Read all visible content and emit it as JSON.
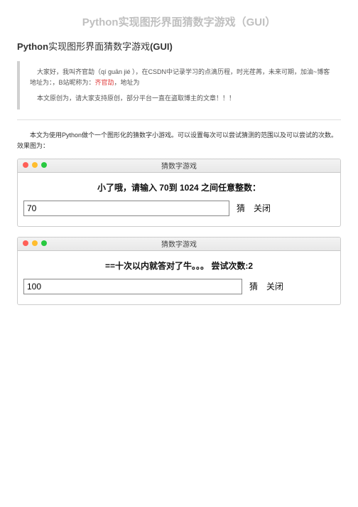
{
  "page": {
    "title": "Python实现图形界面猜数字游戏（GUI）",
    "subtitle_bold": "Python",
    "subtitle_rest": "实现图形界面猜数字游戏",
    "subtitle_paren": "(GUI)",
    "quote": {
      "line1_a": "大家好，我叫齐官劼（qí guān jié ），在CSDN中记录学习的点滴历程，时光荏苒，未来可期，加油~博客地址为：，B站昵称为：",
      "line1_red": "齐官劼",
      "line1_b": "，地址为",
      "line2": "本文原创为，请大家支持原创，部分平台一直在盗取博主的文章！！！"
    },
    "intro_line1": "本文为使用Python做个一个图形化的猜数字小游戏。可以设置每次可以尝试猜测的范围以及可以尝试的次数。",
    "intro_line2": "效果图为："
  },
  "shot1": {
    "window_title": "猜数字游戏",
    "prompt": "小了哦，请输入 70到 1024 之间任意整数：",
    "input_value": "70",
    "btn_guess": "猜",
    "btn_close": "关闭"
  },
  "shot2": {
    "window_title": "猜数字游戏",
    "prompt": "==十次以内就答对了牛。。。 尝试次数:2",
    "input_value": "100",
    "btn_guess": "猜",
    "btn_close": "关闭"
  }
}
